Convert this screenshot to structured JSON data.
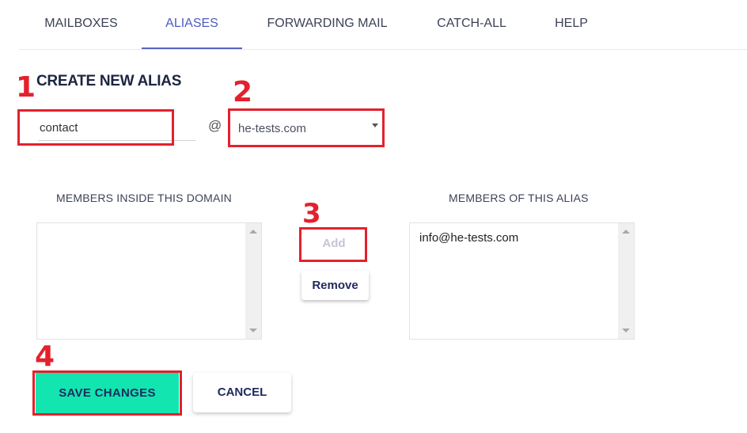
{
  "tabs": [
    {
      "label": "MAILBOXES",
      "active": false
    },
    {
      "label": "ALIASES",
      "active": true
    },
    {
      "label": "FORWARDING MAIL",
      "active": false
    },
    {
      "label": "CATCH-ALL",
      "active": false
    },
    {
      "label": "HELP",
      "active": false
    }
  ],
  "form": {
    "title": "CREATE NEW ALIAS",
    "alias_value": "contact",
    "at_sign": "@",
    "domain_selected": "he-tests.com"
  },
  "members": {
    "domain_label": "MEMBERS INSIDE THIS DOMAIN",
    "domain_options": [],
    "alias_label": "MEMBERS OF THIS ALIAS",
    "alias_options": [
      "info@he-tests.com"
    ],
    "add_label": "Add",
    "remove_label": "Remove"
  },
  "actions": {
    "save_label": "SAVE CHANGES",
    "cancel_label": "CANCEL"
  },
  "annotations": {
    "step1": "1",
    "step2": "2",
    "step3": "3",
    "step4": "4",
    "color": "#e3212d"
  },
  "colors": {
    "accent_tab": "#4c5cc0",
    "save_button": "#12e5b0"
  }
}
